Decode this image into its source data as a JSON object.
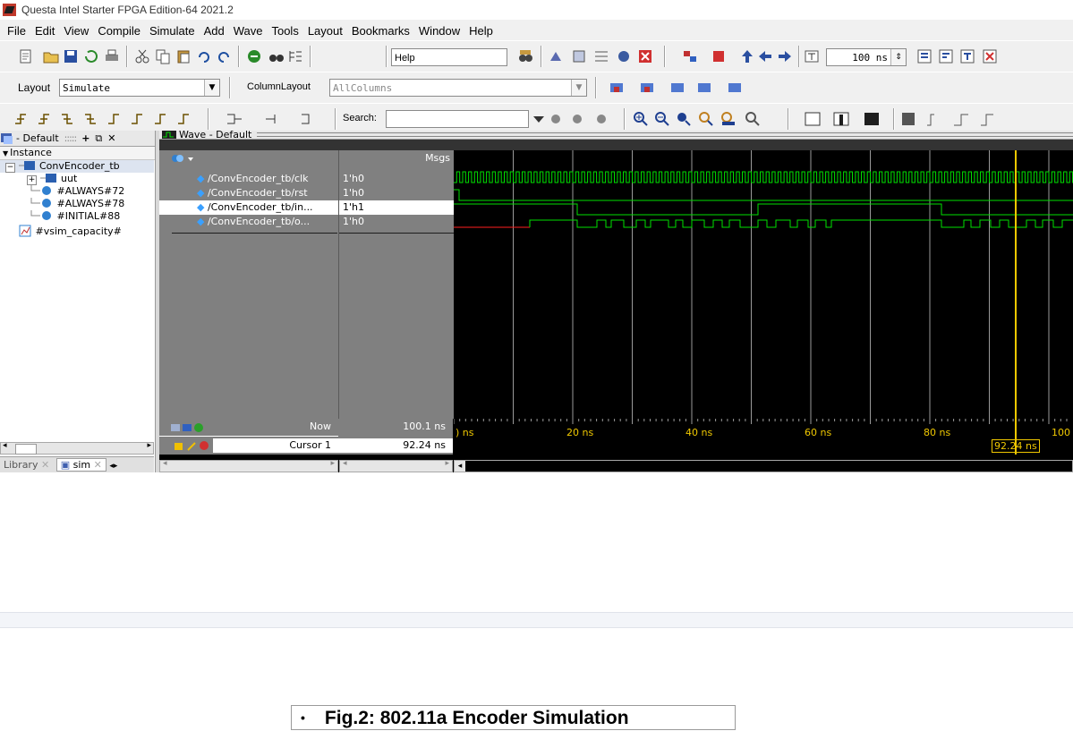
{
  "window": {
    "title": "Questa Intel Starter FPGA Edition-64 2021.2"
  },
  "menu": [
    "File",
    "Edit",
    "View",
    "Compile",
    "Simulate",
    "Add",
    "Wave",
    "Tools",
    "Layout",
    "Bookmarks",
    "Window",
    "Help"
  ],
  "toolbar1": {
    "help_label": "Help",
    "help_value": "",
    "runtime_value": "100 ns"
  },
  "toolbar2": {
    "layout_label": "Layout",
    "layout_value": "Simulate",
    "column_label": "ColumnLayout",
    "column_value": "AllColumns"
  },
  "toolbar3": {
    "search_label": "Search:",
    "search_value": ""
  },
  "leftpane": {
    "header": "- Default",
    "column": "Instance",
    "tree": [
      {
        "label": "ConvEncoder_tb"
      },
      {
        "label": "uut"
      },
      {
        "label": "#ALWAYS#72"
      },
      {
        "label": "#ALWAYS#78"
      },
      {
        "label": "#INITIAL#88"
      },
      {
        "label": "#vsim_capacity#"
      }
    ],
    "tabs": [
      "Library",
      "sim"
    ]
  },
  "wave": {
    "title": "Wave - Default",
    "msgs_header": "Msgs",
    "signals": [
      {
        "name": "/ConvEncoder_tb/clk",
        "value": "1'h0"
      },
      {
        "name": "/ConvEncoder_tb/rst",
        "value": "1'h0"
      },
      {
        "name": "/ConvEncoder_tb/in...",
        "value": "1'h1"
      },
      {
        "name": "/ConvEncoder_tb/o...",
        "value": "1'h0"
      }
    ],
    "now_label": "Now",
    "now_value": "100.1 ns",
    "cursor_label": "Cursor 1",
    "cursor_value": "92.24 ns",
    "cursor_readout": "92.24 ns",
    "time_labels": [
      ") ns",
      "20 ns",
      "40 ns",
      "60 ns",
      "80 ns",
      "100"
    ],
    "colors": {
      "signal": "#00e000",
      "undefined": "#ff2020",
      "cursor": "#f0c800"
    }
  },
  "caption": {
    "bullet": "•",
    "text": "Fig.2: 802.11a Encoder Simulation"
  }
}
